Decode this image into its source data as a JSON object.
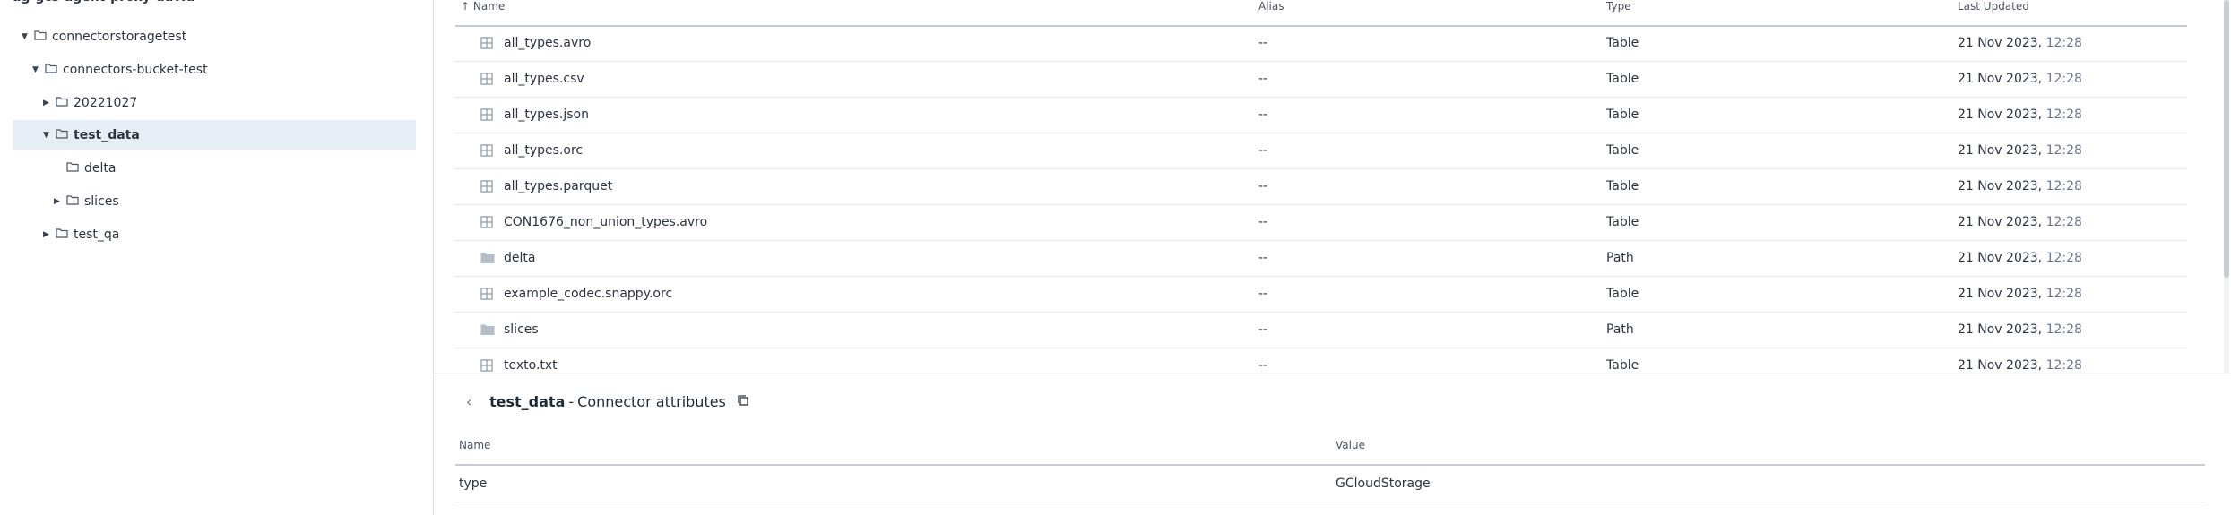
{
  "sidebar": {
    "top_label": "ag-gcs-agent-proxy-david",
    "items": [
      {
        "label": "connectorstoragetest",
        "caret": "▼"
      },
      {
        "label": "connectors-bucket-test",
        "caret": "▼"
      },
      {
        "label": "20221027",
        "caret": "▶"
      },
      {
        "label": "test_data",
        "caret": "▼"
      },
      {
        "label": "delta",
        "caret": ""
      },
      {
        "label": "slices",
        "caret": "▶"
      },
      {
        "label": "test_qa",
        "caret": "▶"
      }
    ]
  },
  "table": {
    "sort_icon": "↑",
    "headers": {
      "name": "Name",
      "alias": "Alias",
      "type": "Type",
      "updated": "Last Updated"
    },
    "rows": [
      {
        "icon": "table-icon",
        "name": "all_types.avro",
        "alias": "--",
        "type": "Table",
        "date": "21 Nov 2023,",
        "time": "12:28"
      },
      {
        "icon": "table-icon",
        "name": "all_types.csv",
        "alias": "--",
        "type": "Table",
        "date": "21 Nov 2023,",
        "time": "12:28"
      },
      {
        "icon": "table-icon",
        "name": "all_types.json",
        "alias": "--",
        "type": "Table",
        "date": "21 Nov 2023,",
        "time": "12:28"
      },
      {
        "icon": "table-icon",
        "name": "all_types.orc",
        "alias": "--",
        "type": "Table",
        "date": "21 Nov 2023,",
        "time": "12:28"
      },
      {
        "icon": "table-icon",
        "name": "all_types.parquet",
        "alias": "--",
        "type": "Table",
        "date": "21 Nov 2023,",
        "time": "12:28"
      },
      {
        "icon": "table-icon",
        "name": "CON1676_non_union_types.avro",
        "alias": "--",
        "type": "Table",
        "date": "21 Nov 2023,",
        "time": "12:28"
      },
      {
        "icon": "folder-icon",
        "name": "delta",
        "alias": "--",
        "type": "Path",
        "date": "21 Nov 2023,",
        "time": "12:28"
      },
      {
        "icon": "table-icon",
        "name": "example_codec.snappy.orc",
        "alias": "--",
        "type": "Table",
        "date": "21 Nov 2023,",
        "time": "12:28"
      },
      {
        "icon": "folder-icon",
        "name": "slices",
        "alias": "--",
        "type": "Path",
        "date": "21 Nov 2023,",
        "time": "12:28"
      },
      {
        "icon": "table-icon",
        "name": "texto.txt",
        "alias": "--",
        "type": "Table",
        "date": "21 Nov 2023,",
        "time": "12:28"
      }
    ]
  },
  "panel": {
    "back_icon": "‹",
    "title_name": "test_data",
    "title_sep": "-",
    "title_rest": "Connector attributes",
    "headers": {
      "name": "Name",
      "value": "Value"
    },
    "rows": [
      {
        "name": "type",
        "value": "GCloudStorage"
      }
    ]
  },
  "colors": {
    "accent_time": "#6b7a90",
    "selected_bg": "#e8eef6",
    "icon": "#8a95a5"
  }
}
